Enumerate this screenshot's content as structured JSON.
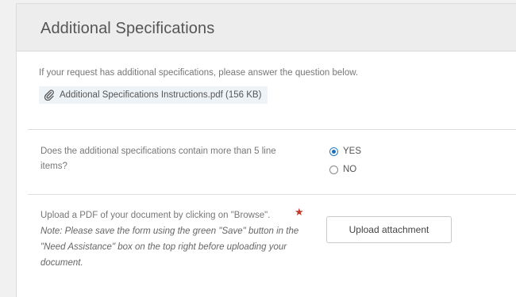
{
  "section": {
    "title": "Additional Specifications",
    "intro": "If your request has additional specifications, please answer the question below.",
    "attachment": {
      "icon": "paperclip-icon",
      "link_text": "Additional Specifications Instructions.pdf (156 KB)"
    }
  },
  "question": {
    "label": "Does the additional specifications contain more than 5 line items?",
    "options": [
      {
        "label": "YES",
        "selected": true
      },
      {
        "label": "NO",
        "selected": false
      }
    ]
  },
  "upload": {
    "label": "Upload a PDF of your document by clicking on \"Browse\".",
    "note": "Note: Please save the form using the green \"Save\" button in the \"Need Assistance\" box on the top right before uploading your document.",
    "required_mark": "★",
    "button_label": "Upload attachment"
  },
  "colors": {
    "accent": "#1f6fb8",
    "required": "#c0392b",
    "header_bg": "#ededed"
  }
}
